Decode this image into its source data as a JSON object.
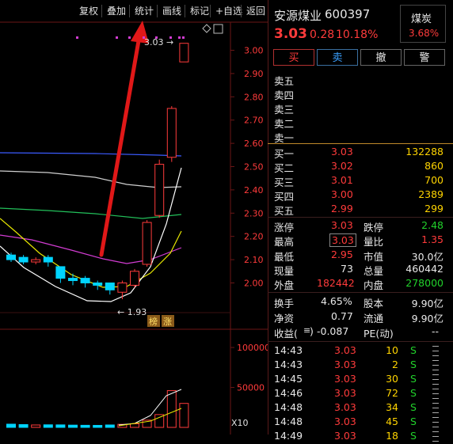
{
  "toolbar": {
    "items": [
      "复权",
      "叠加",
      "统计",
      "画线",
      "标记",
      "+自选",
      "返回"
    ]
  },
  "stock": {
    "name": "安源煤业",
    "code": "600397",
    "price": "3.03",
    "change": "0.28",
    "pct": "10.18%",
    "sector": "煤炭",
    "sector_pct": "3.68%"
  },
  "actions": {
    "buy": "买",
    "sell": "卖",
    "cancel": "撤",
    "alert": "警"
  },
  "ask": [
    {
      "label": "卖五"
    },
    {
      "label": "卖四"
    },
    {
      "label": "卖三"
    },
    {
      "label": "卖二"
    },
    {
      "label": "卖一"
    }
  ],
  "bid": [
    {
      "label": "买一",
      "price": "3.03",
      "vol": "132288"
    },
    {
      "label": "买二",
      "price": "3.02",
      "vol": "860"
    },
    {
      "label": "买三",
      "price": "3.01",
      "vol": "700"
    },
    {
      "label": "买四",
      "price": "3.00",
      "vol": "2389"
    },
    {
      "label": "买五",
      "price": "2.99",
      "vol": "299"
    }
  ],
  "stats": {
    "zhangting_l": "涨停",
    "zhangting": "3.03",
    "dieting_l": "跌停",
    "dieting": "2.48",
    "high_l": "最高",
    "high": "3.03",
    "liangbi_l": "量比",
    "liangbi": "1.35",
    "low_l": "最低",
    "low": "2.95",
    "shizhi_l": "市值",
    "shizhi": "30.0亿",
    "xianliang_l": "现量",
    "xianliang": "73",
    "zongliang_l": "总量",
    "zongliang": "460442",
    "waipan_l": "外盘",
    "waipan": "182442",
    "neipan_l": "内盘",
    "neipan": "278000",
    "huanshou_l": "换手",
    "huanshou": "4.65%",
    "guben_l": "股本",
    "guben": "9.90亿",
    "jingzi_l": "净资",
    "jingzi": "0.77",
    "liutong_l": "流通",
    "liutong": "9.90亿",
    "shouyi_l": "收益(",
    "shouyi_q": "≡",
    "shouyi_r": ")",
    "shouyi": "-0.087",
    "pe_l": "PE(动)",
    "pe": "--"
  },
  "ticks": [
    {
      "time": "14:43",
      "price": "3.03",
      "vol": "10",
      "side": "S"
    },
    {
      "time": "14:43",
      "price": "3.03",
      "vol": "2",
      "side": "S"
    },
    {
      "time": "14:45",
      "price": "3.03",
      "vol": "30",
      "side": "S"
    },
    {
      "time": "14:46",
      "price": "3.03",
      "vol": "72",
      "side": "S"
    },
    {
      "time": "14:48",
      "price": "3.03",
      "vol": "34",
      "side": "S"
    },
    {
      "time": "14:48",
      "price": "3.03",
      "vol": "45",
      "side": "S"
    },
    {
      "time": "14:49",
      "price": "3.03",
      "vol": "18",
      "side": "S"
    }
  ],
  "chart_data": {
    "type": "candlestick",
    "price_axis": [
      "3.00",
      "2.90",
      "2.80",
      "2.70",
      "2.60",
      "2.50",
      "2.40",
      "2.30",
      "2.20",
      "2.10",
      "2.00"
    ],
    "ylim": [
      1.92,
      3.08
    ],
    "candles": [
      {
        "o": 2.12,
        "c": 2.1,
        "h": 2.13,
        "l": 2.09
      },
      {
        "o": 2.11,
        "c": 2.09,
        "h": 2.12,
        "l": 2.08
      },
      {
        "o": 2.09,
        "c": 2.1,
        "h": 2.11,
        "l": 2.08
      },
      {
        "o": 2.11,
        "c": 2.09,
        "h": 2.12,
        "l": 2.07
      },
      {
        "o": 2.07,
        "c": 2.02,
        "h": 2.07,
        "l": 2.0
      },
      {
        "o": 2.02,
        "c": 2.01,
        "h": 2.04,
        "l": 1.99
      },
      {
        "o": 2.02,
        "c": 2.0,
        "h": 2.03,
        "l": 1.98
      },
      {
        "o": 2.0,
        "c": 1.99,
        "h": 2.01,
        "l": 1.97
      },
      {
        "o": 2.0,
        "c": 1.97,
        "h": 2.0,
        "l": 1.95
      },
      {
        "o": 1.96,
        "c": 2.0,
        "h": 2.01,
        "l": 1.93
      },
      {
        "o": 1.99,
        "c": 2.05,
        "h": 2.06,
        "l": 1.98
      },
      {
        "o": 2.08,
        "c": 2.26,
        "h": 2.27,
        "l": 2.07
      },
      {
        "o": 2.29,
        "c": 2.51,
        "h": 2.53,
        "l": 2.28
      },
      {
        "o": 2.54,
        "c": 2.75,
        "h": 2.76,
        "l": 2.52
      },
      {
        "o": 2.95,
        "c": 3.03,
        "h": 3.03,
        "l": 2.95
      }
    ],
    "min_label": "1.93",
    "max_label": "3.03",
    "badges": [
      "榜",
      "涨"
    ],
    "volume_axis": [
      "100000",
      "50000"
    ],
    "volume_unit": "X10",
    "volumes": [
      4000,
      3500,
      3000,
      3200,
      3100,
      2800,
      2600,
      2500,
      3000,
      3800,
      4500,
      9000,
      16000,
      46000,
      30000
    ]
  }
}
